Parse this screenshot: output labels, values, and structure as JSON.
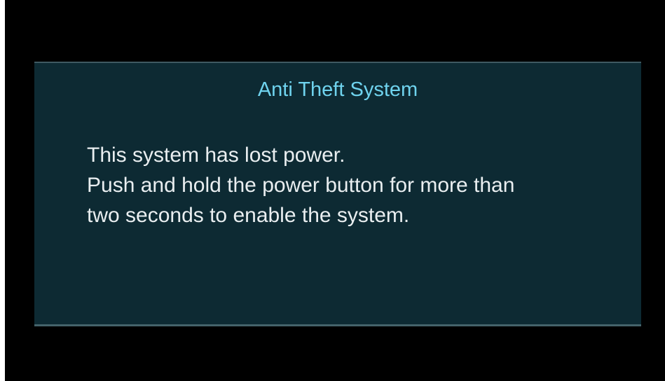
{
  "dialog": {
    "title": "Anti Theft System",
    "message_lines": [
      "This system has lost power.",
      "Push and hold the power button for more than",
      "two seconds to enable the system."
    ]
  },
  "colors": {
    "background": "#000000",
    "dialog_background": "#0d2a33",
    "title": "#6fd3ee",
    "message_text": "#e9eef0"
  }
}
